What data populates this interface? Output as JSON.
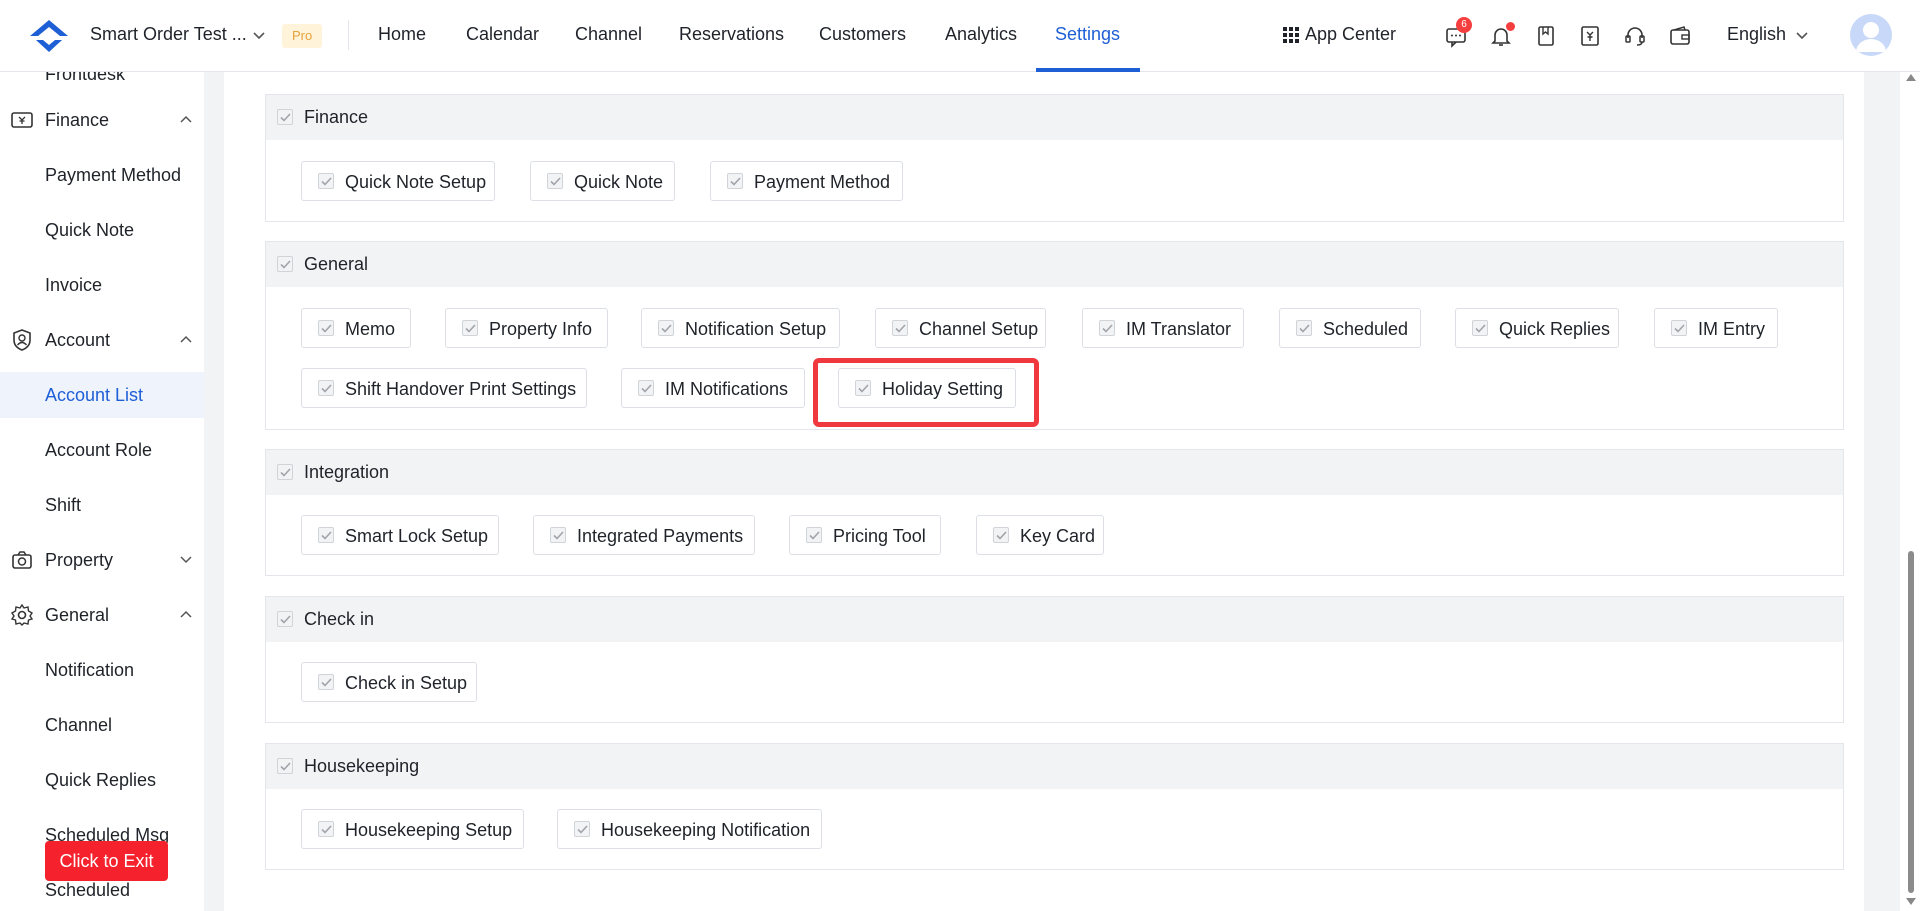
{
  "header": {
    "brand_name": "Smart Order Test ...",
    "badge": "Pro",
    "nav": [
      "Home",
      "Calendar",
      "Channel",
      "Reservations",
      "Customers",
      "Analytics",
      "Settings"
    ],
    "active_nav": "Settings",
    "app_center": "App Center",
    "message_count": "6",
    "language": "English",
    "accent_color": "#1e5fd6"
  },
  "sidebar": {
    "partial_top": "Frontdesk",
    "finance": {
      "label": "Finance",
      "items": [
        "Payment Method",
        "Quick Note",
        "Invoice"
      ]
    },
    "account": {
      "label": "Account",
      "items": [
        "Account List",
        "Account Role",
        "Shift"
      ]
    },
    "active_item": "Account List",
    "property": {
      "label": "Property"
    },
    "general": {
      "label": "General",
      "items": [
        "Notification",
        "Channel",
        "Quick Replies",
        "Scheduled Msg",
        "Scheduled"
      ]
    },
    "exit_button": "Click to Exit"
  },
  "sections": [
    {
      "title": "Finance",
      "options": [
        "Quick Note Setup",
        "Quick Note",
        "Payment Method"
      ]
    },
    {
      "title": "General",
      "options": [
        "Memo",
        "Property Info",
        "Notification Setup",
        "Channel Setup",
        "IM Translator",
        "Scheduled",
        "Quick Replies",
        "IM Entry",
        "Shift Handover Print Settings",
        "IM Notifications",
        "Holiday Setting"
      ]
    },
    {
      "title": "Integration",
      "options": [
        "Smart Lock Setup",
        "Integrated Payments",
        "Pricing Tool",
        "Key Card"
      ]
    },
    {
      "title": "Check in",
      "options": [
        "Check in Setup"
      ]
    },
    {
      "title": "Housekeeping",
      "options": [
        "Housekeeping Setup",
        "Housekeeping Notification"
      ]
    }
  ],
  "highlighted_option": "Holiday Setting",
  "highlight_color": "#f0383f"
}
